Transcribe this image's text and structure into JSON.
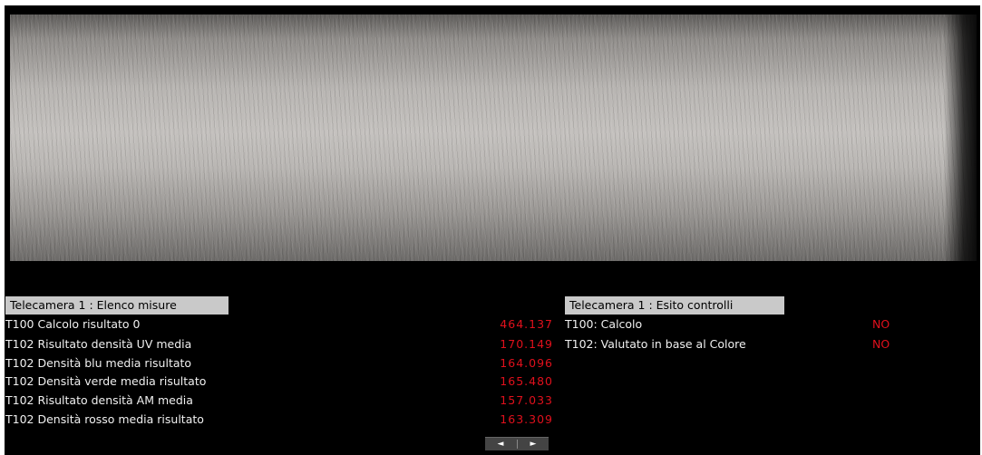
{
  "measures_panel": {
    "title": "Telecamera  1  : Elenco misure",
    "rows": [
      {
        "label": "T100  Calcolo risultato 0",
        "value": "464.137"
      },
      {
        "label": "T102  Risultato densità UV media",
        "value": "170.149"
      },
      {
        "label": "T102  Densità blu media risultato",
        "value": "164.096"
      },
      {
        "label": "T102  Densità verde media risultato",
        "value": "165.480"
      },
      {
        "label": "T102  Risultato densità AM media",
        "value": "157.033"
      },
      {
        "label": "T102  Densità rosso media risultato",
        "value": "163.309"
      }
    ]
  },
  "checks_panel": {
    "title": "Telecamera  1  : Esito controlli",
    "rows": [
      {
        "label": "T100: Calcolo",
        "result": "NO"
      },
      {
        "label": "T102: Valutato  in  base  al  Colore",
        "result": "NO"
      }
    ]
  },
  "pager": {
    "prev_icon": "◄",
    "next_icon": "►"
  },
  "colors": {
    "value_red": "#e0101c",
    "header_bg": "#c9c9c9",
    "background": "#000000"
  }
}
